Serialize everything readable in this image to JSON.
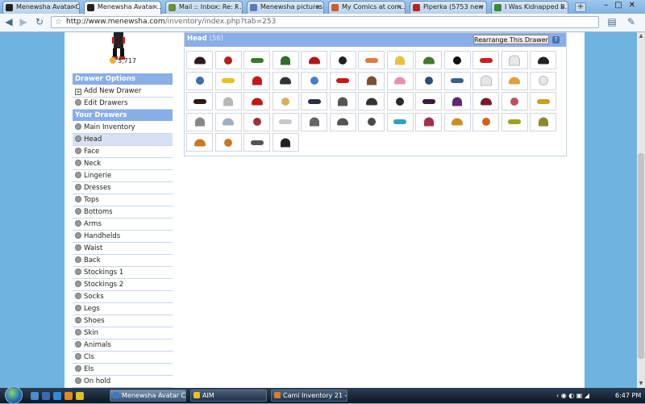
{
  "tabs": [
    {
      "title": "Menewsha Avatar C",
      "active": false,
      "color": "#222222"
    },
    {
      "title": "Menewsha Avatar ...",
      "active": true,
      "color": "#222222"
    },
    {
      "title": "Mail :: Inbox: Re: F...",
      "active": false,
      "color": "#6b8f3a"
    },
    {
      "title": "Menewsha pictures...",
      "active": false,
      "color": "#5a7ab8"
    },
    {
      "title": "My Comics at com...",
      "active": false,
      "color": "#d05a2a"
    },
    {
      "title": "Piperka (5753 new i...",
      "active": false,
      "color": "#c02020"
    },
    {
      "title": "I Was Kidnapped B...",
      "active": false,
      "color": "#3a8a3a"
    }
  ],
  "toolbar": {
    "url_host": "http://www.menewsha.com",
    "url_path": "/inventory/index.php?tab=253"
  },
  "user": {
    "coins": "5,717"
  },
  "sidebar": {
    "options_header": "Drawer Options",
    "options": [
      {
        "label": "Add New Drawer",
        "icon": "plus-icon"
      },
      {
        "label": "Edit Drawers",
        "icon": "gear-icon"
      }
    ],
    "drawers_header": "Your Drawers",
    "drawers": [
      "Main Inventory",
      "Head",
      "Face",
      "Neck",
      "Lingerie",
      "Dresses",
      "Tops",
      "Bottoms",
      "Arms",
      "Handhelds",
      "Waist",
      "Back",
      "Stockings 1",
      "Stockings 2",
      "Socks",
      "Legs",
      "Shoes",
      "Skin",
      "Animals",
      "CIs",
      "EIs",
      "On hold",
      "All Items"
    ],
    "selected": "Head"
  },
  "drawer": {
    "title": "Head",
    "count": "(56)",
    "rearrange_label": "Rearrange This Drawer",
    "help_label": "?"
  },
  "items": [
    "#2a1a1a",
    "#b81e1e",
    "#3a7a2a",
    "#2f6e2a",
    "#b01818",
    "#222222",
    "#e07a40",
    "#e8c040",
    "#3f7a24",
    "#111111",
    "#c92020",
    "#e8e8e8",
    "#222222",
    "#3d6fa8",
    "#e8c020",
    "#c81818",
    "#333333",
    "#4a7fc0",
    "#c81818",
    "#7a5030",
    "#e890b0",
    "#2b4f7a",
    "#3a5f8a",
    "#e6e6e6",
    "#e0a040",
    "#e6e6e6",
    "#2a1a12",
    "#b8b8b8",
    "#c01818",
    "#d8b060",
    "#2a3040",
    "#555555",
    "#333333",
    "#2a2a2a",
    "#3a1a3a",
    "#5a2a6a",
    "#7a1a2a",
    "#c05060",
    "#c8a020",
    "#888888",
    "#a0b0c0",
    "#a03040",
    "#c8c8c8",
    "#666666",
    "#555555",
    "#4a4a4a",
    "#30a0c0",
    "#a03050",
    "#c89020",
    "#d06020",
    "#a0a020",
    "#8a8a30",
    "#c87820",
    "#c87820",
    "#555555",
    "#222222"
  ],
  "taskbar": {
    "tasks": [
      {
        "label": "Menewsha Avatar C...",
        "active": true,
        "color": "#3b78c8"
      },
      {
        "label": "AIM",
        "active": false,
        "color": "#f0c020"
      },
      {
        "label": "Cami Inventory 21 - ...",
        "active": false,
        "color": "#d08030"
      }
    ],
    "clock": "6:47 PM"
  },
  "colors": {
    "accent": "#8aaee6",
    "background": "#6fb3e1"
  }
}
